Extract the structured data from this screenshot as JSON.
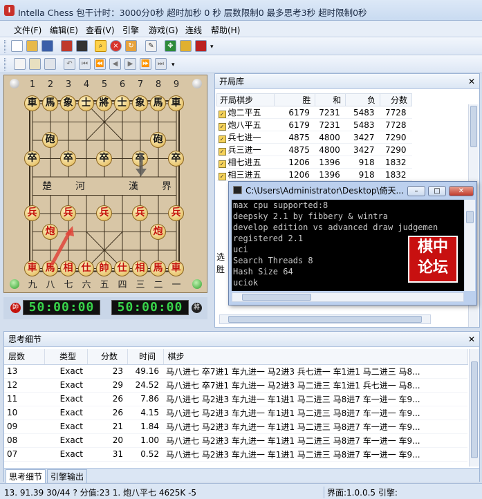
{
  "window": {
    "title": "Intella Chess 包干计时：3000分0秒 超时加秒 0 秒 层数限制0 最多思考3秒 超时限制0秒"
  },
  "menu": [
    "文件(F)",
    "编辑(E)",
    "查看(V)",
    "引擎",
    "游戏(G)",
    "连线",
    "帮助(H)"
  ],
  "board": {
    "top_numbers": [
      "1",
      "2",
      "3",
      "4",
      "5",
      "6",
      "7",
      "8",
      "9"
    ],
    "bottom_numbers": [
      "九",
      "八",
      "七",
      "六",
      "五",
      "四",
      "三",
      "二",
      "一"
    ],
    "river": [
      "楚",
      "河",
      "漢",
      "界"
    ],
    "pieces": [
      {
        "c": "車",
        "s": "b",
        "f": 0,
        "r": 0
      },
      {
        "c": "馬",
        "s": "b",
        "f": 1,
        "r": 0
      },
      {
        "c": "象",
        "s": "b",
        "f": 2,
        "r": 0
      },
      {
        "c": "士",
        "s": "b",
        "f": 3,
        "r": 0
      },
      {
        "c": "將",
        "s": "b",
        "f": 4,
        "r": 0
      },
      {
        "c": "士",
        "s": "b",
        "f": 5,
        "r": 0
      },
      {
        "c": "象",
        "s": "b",
        "f": 6,
        "r": 0
      },
      {
        "c": "馬",
        "s": "b",
        "f": 7,
        "r": 0
      },
      {
        "c": "車",
        "s": "b",
        "f": 8,
        "r": 0
      },
      {
        "c": "砲",
        "s": "b",
        "f": 1,
        "r": 2
      },
      {
        "c": "砲",
        "s": "b",
        "f": 7,
        "r": 2
      },
      {
        "c": "卒",
        "s": "b",
        "f": 0,
        "r": 3
      },
      {
        "c": "卒",
        "s": "b",
        "f": 2,
        "r": 3
      },
      {
        "c": "卒",
        "s": "b",
        "f": 4,
        "r": 3
      },
      {
        "c": "卒",
        "s": "b",
        "f": 6,
        "r": 3
      },
      {
        "c": "卒",
        "s": "b",
        "f": 8,
        "r": 3
      },
      {
        "c": "兵",
        "s": "r",
        "f": 0,
        "r": 6
      },
      {
        "c": "兵",
        "s": "r",
        "f": 2,
        "r": 6
      },
      {
        "c": "兵",
        "s": "r",
        "f": 4,
        "r": 6
      },
      {
        "c": "兵",
        "s": "r",
        "f": 6,
        "r": 6
      },
      {
        "c": "兵",
        "s": "r",
        "f": 8,
        "r": 6
      },
      {
        "c": "炮",
        "s": "r",
        "f": 1,
        "r": 7
      },
      {
        "c": "炮",
        "s": "r",
        "f": 7,
        "r": 7
      },
      {
        "c": "車",
        "s": "r",
        "f": 0,
        "r": 9
      },
      {
        "c": "馬",
        "s": "r",
        "f": 1,
        "r": 9
      },
      {
        "c": "相",
        "s": "r",
        "f": 2,
        "r": 9
      },
      {
        "c": "仕",
        "s": "r",
        "f": 3,
        "r": 9
      },
      {
        "c": "帥",
        "s": "r",
        "f": 4,
        "r": 9
      },
      {
        "c": "仕",
        "s": "r",
        "f": 5,
        "r": 9
      },
      {
        "c": "相",
        "s": "r",
        "f": 6,
        "r": 9
      },
      {
        "c": "馬",
        "s": "r",
        "f": 7,
        "r": 9
      },
      {
        "c": "車",
        "s": "r",
        "f": 8,
        "r": 9
      }
    ]
  },
  "clocks": {
    "red_badge": "帥",
    "red": "50:00:00",
    "black": "50:00:00",
    "black_badge": "將"
  },
  "opening_book": {
    "title": "开局库",
    "headers": [
      "开局棋步",
      "胜",
      "和",
      "负",
      "分数"
    ],
    "rows": [
      [
        "炮二平五",
        "6179",
        "7231",
        "5483",
        "7728"
      ],
      [
        "炮八平五",
        "6179",
        "7231",
        "5483",
        "7728"
      ],
      [
        "兵七进一",
        "4875",
        "4800",
        "3427",
        "7290"
      ],
      [
        "兵三进一",
        "4875",
        "4800",
        "3427",
        "7290"
      ],
      [
        "相七进五",
        "1206",
        "1396",
        "918",
        "1832"
      ],
      [
        "相三进五",
        "1206",
        "1396",
        "918",
        "1832"
      ]
    ],
    "side_labels": [
      "选",
      "胜"
    ]
  },
  "console": {
    "title": "C:\\Users\\Administrator\\Desktop\\倚天...",
    "lines": [
      "max cpu supported:8",
      "deepsky 2.1 by fibbery & wintra",
      "develop edition vs advanced draw judgemen",
      "registered 2.1",
      "uci",
      "Search Threads 8",
      "Hash Size 64",
      "uciok"
    ],
    "logo": [
      "棋",
      "中",
      "论",
      "坛"
    ]
  },
  "thinking": {
    "title": "思考细节",
    "headers": [
      "层数",
      "类型",
      "分数",
      "时间",
      "棋步"
    ],
    "rows": [
      [
        "13",
        "Exact",
        "23",
        "49.16",
        "马八进七 卒7进1 车九进一 马2进3 兵七进一 车1进1 马二进三 马8..."
      ],
      [
        "12",
        "Exact",
        "29",
        "24.52",
        "马八进七 卒7进1 车九进一 马2进3 马二进三 车1进1 兵七进一 马8..."
      ],
      [
        "11",
        "Exact",
        "26",
        "7.86",
        "马八进七 马2进3 车九进一 车1进1 马二进三 马8进7 车一进一 车9..."
      ],
      [
        "10",
        "Exact",
        "26",
        "4.15",
        "马八进七 马2进3 车九进一 车1进1 马二进三 马8进7 车一进一 车9..."
      ],
      [
        "09",
        "Exact",
        "21",
        "1.84",
        "马八进七 马2进3 车九进一 车1进1 马二进三 马8进7 车一进一 车9..."
      ],
      [
        "08",
        "Exact",
        "20",
        "1.00",
        "马八进七 马2进3 车九进一 车1进1 马二进三 马8进7 车一进一 车9..."
      ],
      [
        "07",
        "Exact",
        "31",
        "0.52",
        "马八进七 马2进3 车九进一 车1进1 马二进三 马8进7 车一进一 车9..."
      ]
    ],
    "tabs": [
      "思考细节",
      "引擎输出"
    ]
  },
  "status": {
    "left": "13.  91.39 30/44 ?  分值:23   1. 炮八平七    4625K -5",
    "right": "界面:1.0.0.5 引擎:"
  },
  "colors": {
    "red_piece": "#c4120c",
    "black_piece": "#111111",
    "clock_digits": "#38d34a",
    "logo": "#c81010"
  }
}
